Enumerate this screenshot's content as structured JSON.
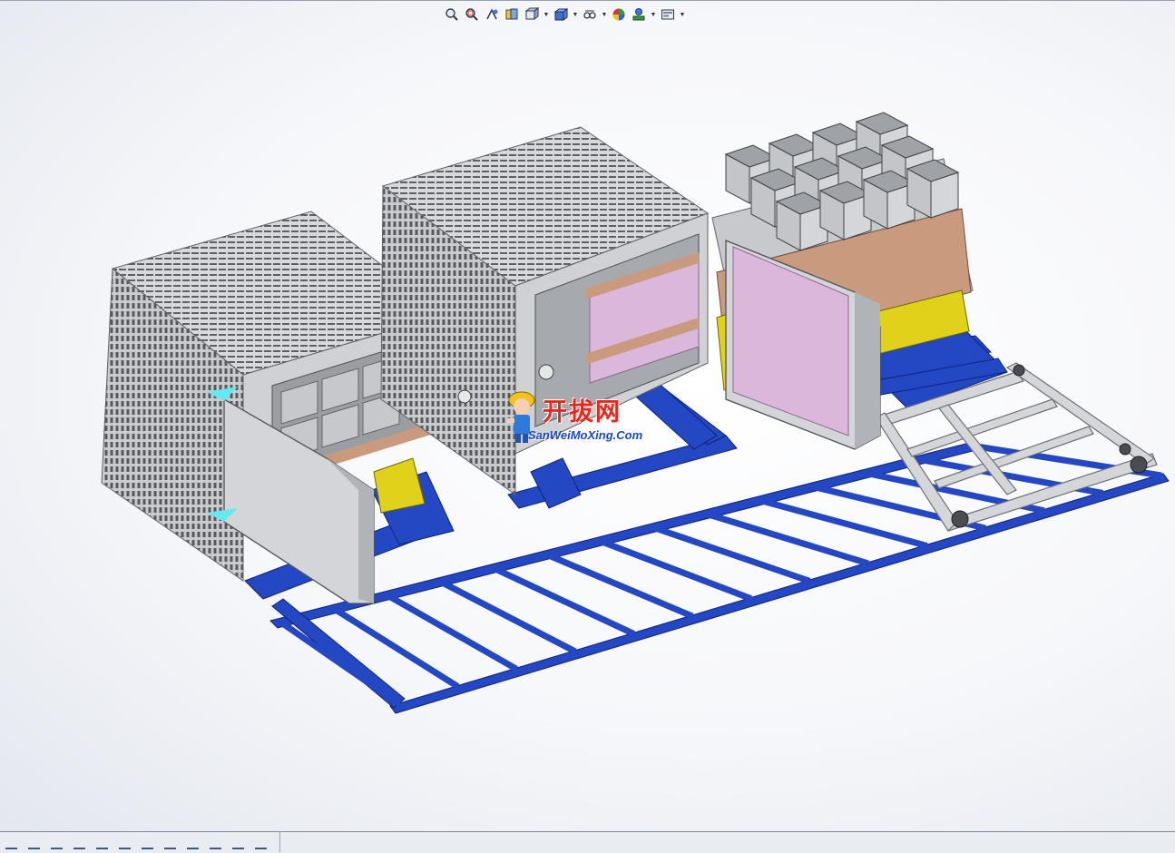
{
  "viewport": {
    "background": "#f6f7fa",
    "accent_frame_color": "#1f3fae",
    "machine_body_color": "#c8cacd",
    "door_panel_color": "#d9b3d8",
    "cylinder_color": "#e5d21a"
  },
  "hud_toolbar": {
    "buttons": [
      {
        "icon": "zoom-to-fit-icon"
      },
      {
        "icon": "zoom-to-area-icon"
      },
      {
        "icon": "previous-view-icon"
      },
      {
        "icon": "section-view-icon"
      },
      {
        "icon": "view-orientation-icon",
        "dropdown": true
      },
      {
        "icon": "display-style-icon",
        "dropdown": true
      },
      {
        "icon": "hide-show-items-icon",
        "dropdown": true
      },
      {
        "icon": "edit-appearance-icon"
      },
      {
        "icon": "apply-scene-icon",
        "dropdown": true
      },
      {
        "icon": "view-settings-icon",
        "dropdown": true
      }
    ]
  },
  "watermark": {
    "chinese": "开拔网",
    "english": "SanWeiMoXing.Com"
  },
  "status_bar": {
    "tab_count": 12
  }
}
